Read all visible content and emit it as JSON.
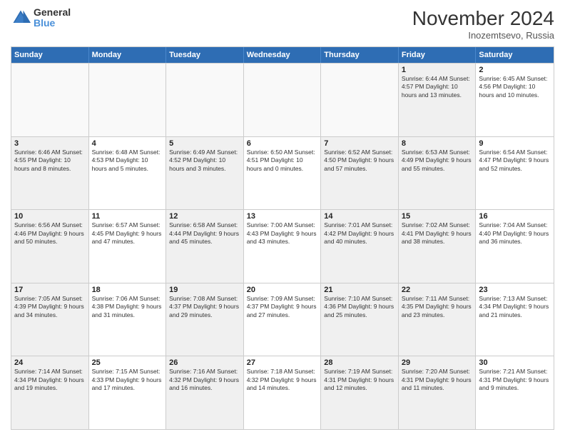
{
  "header": {
    "title": "November 2024",
    "subtitle": "Inozemtsevo, Russia",
    "logo_line1": "General",
    "logo_line2": "Blue"
  },
  "days_of_week": [
    "Sunday",
    "Monday",
    "Tuesday",
    "Wednesday",
    "Thursday",
    "Friday",
    "Saturday"
  ],
  "weeks": [
    [
      {
        "day": "",
        "info": "",
        "empty": true
      },
      {
        "day": "",
        "info": "",
        "empty": true
      },
      {
        "day": "",
        "info": "",
        "empty": true
      },
      {
        "day": "",
        "info": "",
        "empty": true
      },
      {
        "day": "",
        "info": "",
        "empty": true
      },
      {
        "day": "1",
        "info": "Sunrise: 6:44 AM\nSunset: 4:57 PM\nDaylight: 10 hours\nand 13 minutes.",
        "shaded": true
      },
      {
        "day": "2",
        "info": "Sunrise: 6:45 AM\nSunset: 4:56 PM\nDaylight: 10 hours\nand 10 minutes."
      }
    ],
    [
      {
        "day": "3",
        "info": "Sunrise: 6:46 AM\nSunset: 4:55 PM\nDaylight: 10 hours\nand 8 minutes.",
        "shaded": true
      },
      {
        "day": "4",
        "info": "Sunrise: 6:48 AM\nSunset: 4:53 PM\nDaylight: 10 hours\nand 5 minutes."
      },
      {
        "day": "5",
        "info": "Sunrise: 6:49 AM\nSunset: 4:52 PM\nDaylight: 10 hours\nand 3 minutes.",
        "shaded": true
      },
      {
        "day": "6",
        "info": "Sunrise: 6:50 AM\nSunset: 4:51 PM\nDaylight: 10 hours\nand 0 minutes."
      },
      {
        "day": "7",
        "info": "Sunrise: 6:52 AM\nSunset: 4:50 PM\nDaylight: 9 hours\nand 57 minutes.",
        "shaded": true
      },
      {
        "day": "8",
        "info": "Sunrise: 6:53 AM\nSunset: 4:49 PM\nDaylight: 9 hours\nand 55 minutes.",
        "shaded": true
      },
      {
        "day": "9",
        "info": "Sunrise: 6:54 AM\nSunset: 4:47 PM\nDaylight: 9 hours\nand 52 minutes."
      }
    ],
    [
      {
        "day": "10",
        "info": "Sunrise: 6:56 AM\nSunset: 4:46 PM\nDaylight: 9 hours\nand 50 minutes.",
        "shaded": true
      },
      {
        "day": "11",
        "info": "Sunrise: 6:57 AM\nSunset: 4:45 PM\nDaylight: 9 hours\nand 47 minutes."
      },
      {
        "day": "12",
        "info": "Sunrise: 6:58 AM\nSunset: 4:44 PM\nDaylight: 9 hours\nand 45 minutes.",
        "shaded": true
      },
      {
        "day": "13",
        "info": "Sunrise: 7:00 AM\nSunset: 4:43 PM\nDaylight: 9 hours\nand 43 minutes."
      },
      {
        "day": "14",
        "info": "Sunrise: 7:01 AM\nSunset: 4:42 PM\nDaylight: 9 hours\nand 40 minutes.",
        "shaded": true
      },
      {
        "day": "15",
        "info": "Sunrise: 7:02 AM\nSunset: 4:41 PM\nDaylight: 9 hours\nand 38 minutes.",
        "shaded": true
      },
      {
        "day": "16",
        "info": "Sunrise: 7:04 AM\nSunset: 4:40 PM\nDaylight: 9 hours\nand 36 minutes."
      }
    ],
    [
      {
        "day": "17",
        "info": "Sunrise: 7:05 AM\nSunset: 4:39 PM\nDaylight: 9 hours\nand 34 minutes.",
        "shaded": true
      },
      {
        "day": "18",
        "info": "Sunrise: 7:06 AM\nSunset: 4:38 PM\nDaylight: 9 hours\nand 31 minutes."
      },
      {
        "day": "19",
        "info": "Sunrise: 7:08 AM\nSunset: 4:37 PM\nDaylight: 9 hours\nand 29 minutes.",
        "shaded": true
      },
      {
        "day": "20",
        "info": "Sunrise: 7:09 AM\nSunset: 4:37 PM\nDaylight: 9 hours\nand 27 minutes."
      },
      {
        "day": "21",
        "info": "Sunrise: 7:10 AM\nSunset: 4:36 PM\nDaylight: 9 hours\nand 25 minutes.",
        "shaded": true
      },
      {
        "day": "22",
        "info": "Sunrise: 7:11 AM\nSunset: 4:35 PM\nDaylight: 9 hours\nand 23 minutes.",
        "shaded": true
      },
      {
        "day": "23",
        "info": "Sunrise: 7:13 AM\nSunset: 4:34 PM\nDaylight: 9 hours\nand 21 minutes."
      }
    ],
    [
      {
        "day": "24",
        "info": "Sunrise: 7:14 AM\nSunset: 4:34 PM\nDaylight: 9 hours\nand 19 minutes.",
        "shaded": true
      },
      {
        "day": "25",
        "info": "Sunrise: 7:15 AM\nSunset: 4:33 PM\nDaylight: 9 hours\nand 17 minutes."
      },
      {
        "day": "26",
        "info": "Sunrise: 7:16 AM\nSunset: 4:32 PM\nDaylight: 9 hours\nand 16 minutes.",
        "shaded": true
      },
      {
        "day": "27",
        "info": "Sunrise: 7:18 AM\nSunset: 4:32 PM\nDaylight: 9 hours\nand 14 minutes."
      },
      {
        "day": "28",
        "info": "Sunrise: 7:19 AM\nSunset: 4:31 PM\nDaylight: 9 hours\nand 12 minutes.",
        "shaded": true
      },
      {
        "day": "29",
        "info": "Sunrise: 7:20 AM\nSunset: 4:31 PM\nDaylight: 9 hours\nand 11 minutes.",
        "shaded": true
      },
      {
        "day": "30",
        "info": "Sunrise: 7:21 AM\nSunset: 4:31 PM\nDaylight: 9 hours\nand 9 minutes."
      }
    ]
  ]
}
